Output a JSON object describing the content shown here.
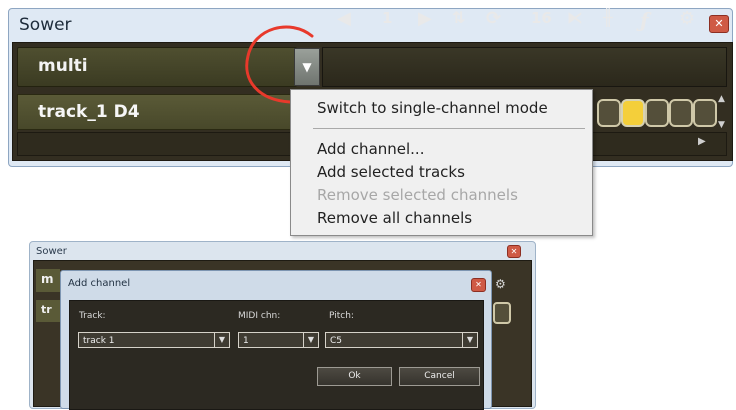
{
  "colors": {
    "accent_red": "#e8392b",
    "menu_bg": "#f0f0f0",
    "panel_dark": "#332e21",
    "step_active": "#f4cf3a"
  },
  "main_window": {
    "title": "Sower",
    "mode": "multi",
    "toolbar": {
      "position": "1",
      "steps": "16"
    },
    "track": "track_1 D4"
  },
  "context_menu": {
    "items": [
      {
        "label": "Switch to single-channel mode",
        "enabled": true
      },
      {
        "label": "Add channel...",
        "enabled": true
      },
      {
        "label": "Add selected tracks",
        "enabled": true
      },
      {
        "label": "Remove selected channels",
        "enabled": false
      },
      {
        "label": "Remove all channels",
        "enabled": true
      }
    ]
  },
  "bg_window": {
    "title": "Sower",
    "left_mode_fragment": "m",
    "left_track_fragment": "tr"
  },
  "add_channel_dialog": {
    "title": "Add channel",
    "labels": {
      "track": "Track:",
      "midi": "MIDI chn:",
      "pitch": "Pitch:"
    },
    "values": {
      "track": "track 1",
      "midi": "1",
      "pitch": "C5"
    },
    "buttons": {
      "ok": "Ok",
      "cancel": "Cancel"
    }
  }
}
